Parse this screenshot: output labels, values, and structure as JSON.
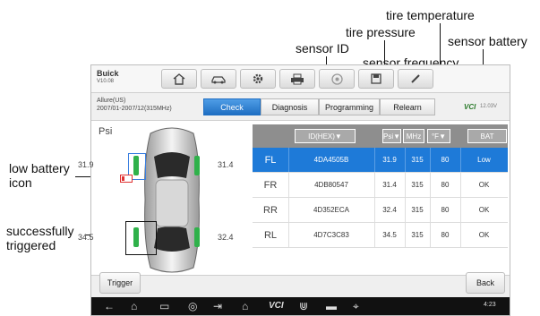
{
  "annotations": {
    "tire_temperature": "tire temperature",
    "tire_pressure": "tire pressure",
    "sensor_id": "sensor ID",
    "sensor_frequency": "sensor frequency",
    "sensor_battery": "sensor battery",
    "low_battery_icon": "low battery\nicon",
    "successfully_triggered": "successfully\ntriggered"
  },
  "header": {
    "vehicle": "Buick",
    "version": "V10.08",
    "icons": [
      "home-icon",
      "car-icon",
      "gear-icon",
      "printer-icon",
      "help-icon",
      "save-icon",
      "edit-icon"
    ]
  },
  "subheader": {
    "model_line1": "Allure(US)",
    "model_line2": "2007/01-2007/12(315MHz)",
    "tabs": [
      "Check",
      "Diagnosis",
      "Programming",
      "Relearn"
    ],
    "active_tab": "Check",
    "vci_logo": "VCI",
    "status": "12.03V"
  },
  "wheels": {
    "unit": "Psi",
    "fl": "31.9",
    "fr": "31.4",
    "rl": "34.5",
    "rr": "32.4"
  },
  "table": {
    "headers": [
      "ID(HEX)▼",
      "Psi▼",
      "MHz",
      "°F▼",
      "BAT"
    ],
    "rows": [
      {
        "pos": "FL",
        "id": "4DA4505B",
        "psi": "31.9",
        "mhz": "315",
        "temp": "80",
        "bat": "Low"
      },
      {
        "pos": "FR",
        "id": "4DB80547",
        "psi": "31.4",
        "mhz": "315",
        "temp": "80",
        "bat": "OK"
      },
      {
        "pos": "RR",
        "id": "4D352ECA",
        "psi": "32.4",
        "mhz": "315",
        "temp": "80",
        "bat": "OK"
      },
      {
        "pos": "RL",
        "id": "4D7C3C83",
        "psi": "34.5",
        "mhz": "315",
        "temp": "80",
        "bat": "OK"
      }
    ]
  },
  "buttons": {
    "trigger": "Trigger",
    "back": "Back"
  },
  "navbar": {
    "time": "4:23",
    "vci": "VCI"
  },
  "colors": {
    "selected_row": "#1e7ad8",
    "tab_active": "#1f6fc3",
    "tire_ok": "#2fb14a",
    "low_battery": "#e03030"
  }
}
